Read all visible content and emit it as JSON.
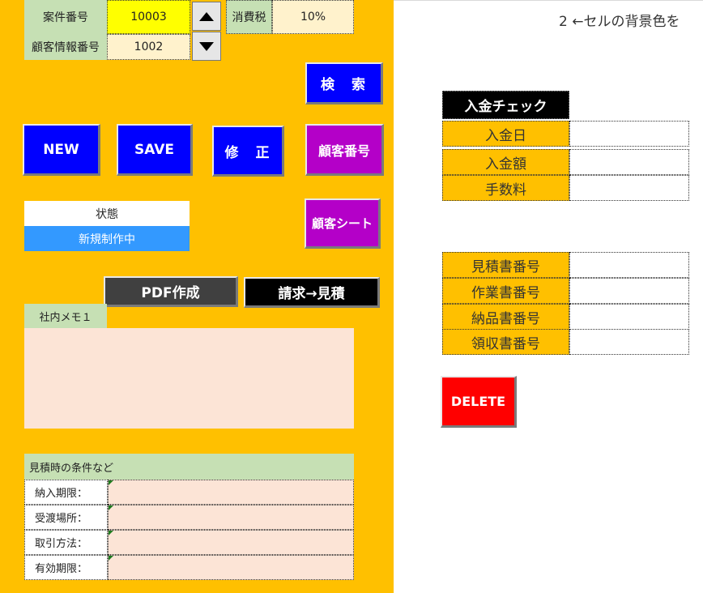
{
  "header": {
    "case_no_label": "案件番号",
    "case_no_value": "10003",
    "customer_info_label": "顧客情報番号",
    "customer_info_value": "1002",
    "tax_label": "消費税",
    "tax_value": "10%"
  },
  "note": {
    "text": "2 ←セルの背景色を"
  },
  "buttons": {
    "search": "検　索",
    "new": "NEW",
    "save": "SAVE",
    "modify": "修　正",
    "customer_no": "顧客番号",
    "customer_sheet": "顧客シート",
    "pdf": "PDF作成",
    "invoice_to_estimate": "請求→見積",
    "delete": "DELETE"
  },
  "status": {
    "label": "状態",
    "value": "新規制作中"
  },
  "memo": {
    "label": "社内メモ１",
    "value": ""
  },
  "conditions": {
    "title": "見積時の条件など",
    "rows": [
      {
        "label": "納入期限：",
        "value": ""
      },
      {
        "label": "受渡場所：",
        "value": ""
      },
      {
        "label": "取引方法：",
        "value": ""
      },
      {
        "label": "有効期限：",
        "value": ""
      }
    ]
  },
  "payment": {
    "title": "入金チェック",
    "rows": [
      {
        "label": "入金日",
        "value": ""
      },
      {
        "label": "入金額",
        "value": ""
      },
      {
        "label": "手数料",
        "value": ""
      }
    ]
  },
  "documents": {
    "rows": [
      {
        "label": "見積書番号",
        "value": ""
      },
      {
        "label": "作業書番号",
        "value": ""
      },
      {
        "label": "納品書番号",
        "value": ""
      },
      {
        "label": "領収書番号",
        "value": ""
      }
    ]
  },
  "icons": {
    "up": "arrow-up-icon",
    "down": "arrow-down-icon"
  },
  "colors": {
    "panel": "#ffc000",
    "primary": "#0000ff",
    "accent": "#b400c8",
    "danger": "#ff0000"
  }
}
